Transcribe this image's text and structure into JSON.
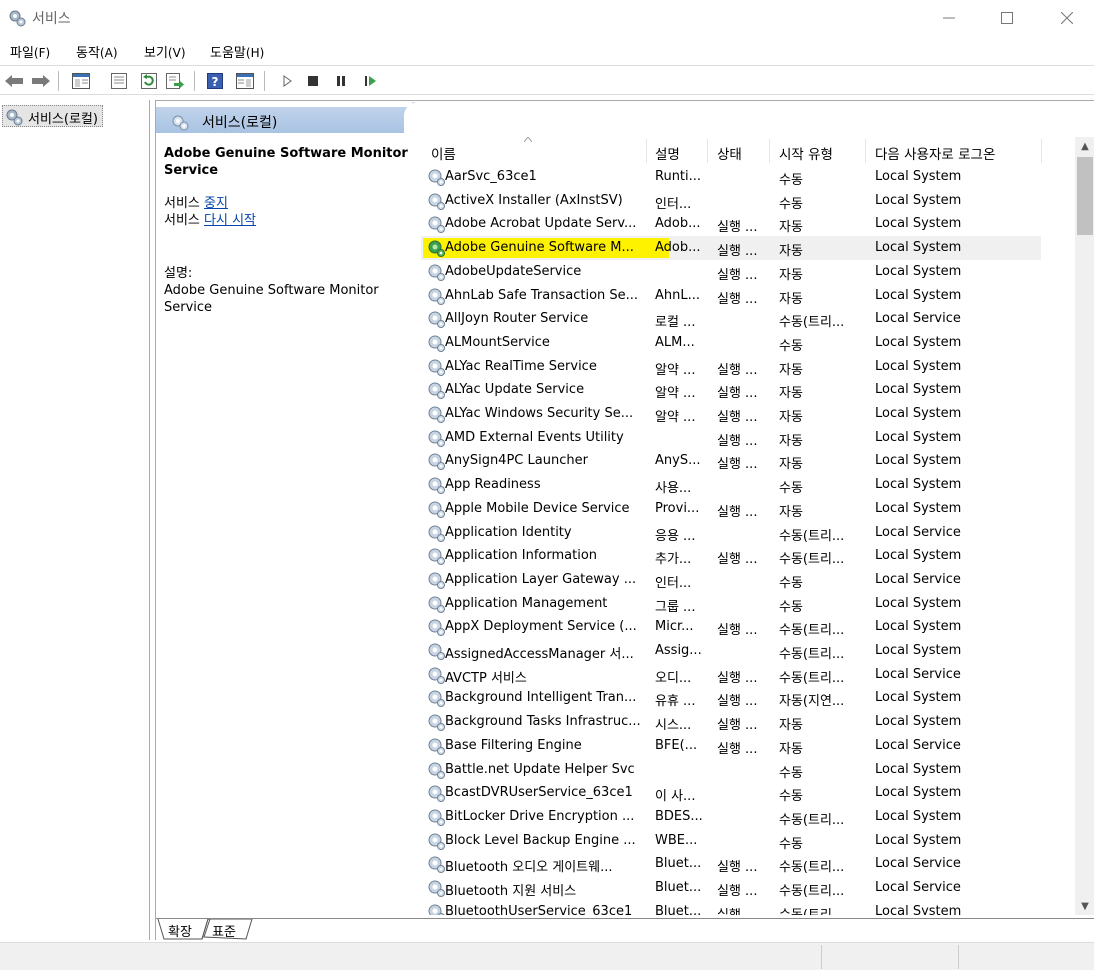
{
  "window": {
    "title": "서비스"
  },
  "menu": [
    {
      "label": "파일",
      "acc": "(F)"
    },
    {
      "label": "동작",
      "acc": "(A)"
    },
    {
      "label": "보기",
      "acc": "(V)"
    },
    {
      "label": "도움말",
      "acc": "(H)"
    }
  ],
  "tree": {
    "item": "서비스(로컬)"
  },
  "pane": {
    "title": "서비스(로컬)"
  },
  "details": {
    "service_name": "Adobe Genuine Software Monitor Service",
    "action_prefix_1": "서비스 ",
    "action_link_1": "중지",
    "action_prefix_2": "서비스 ",
    "action_link_2": "다시 시작",
    "desc_label": "설명:",
    "desc_text": "Adobe Genuine Software Monitor Service"
  },
  "columns": [
    "이름",
    "설명",
    "상태",
    "시작 유형",
    "다음 사용자로 로그온"
  ],
  "rows": [
    [
      "AarSvc_63ce1",
      "Runti...",
      "",
      "수동",
      "Local System"
    ],
    [
      "ActiveX Installer (AxInstSV)",
      "인터...",
      "",
      "수동",
      "Local System"
    ],
    [
      "Adobe Acrobat Update Serv...",
      "Adob...",
      "실행 ...",
      "자동",
      "Local System"
    ],
    [
      "Adobe Genuine Software M...",
      "Adob...",
      "실행 ...",
      "자동",
      "Local System"
    ],
    [
      "AdobeUpdateService",
      "",
      "실행 ...",
      "자동",
      "Local System"
    ],
    [
      "AhnLab Safe Transaction Se...",
      "AhnL...",
      "실행 ...",
      "자동",
      "Local System"
    ],
    [
      "AllJoyn Router Service",
      "로컬 ...",
      "",
      "수동(트리...",
      "Local Service"
    ],
    [
      "ALMountService",
      "ALM...",
      "",
      "수동",
      "Local System"
    ],
    [
      "ALYac RealTime Service",
      "알약 ...",
      "실행 ...",
      "자동",
      "Local System"
    ],
    [
      "ALYac Update Service",
      "알약 ...",
      "실행 ...",
      "자동",
      "Local System"
    ],
    [
      "ALYac Windows Security Se...",
      "알약 ...",
      "실행 ...",
      "자동",
      "Local System"
    ],
    [
      "AMD External Events Utility",
      "",
      "실행 ...",
      "자동",
      "Local System"
    ],
    [
      "AnySign4PC Launcher",
      "AnyS...",
      "실행 ...",
      "자동",
      "Local System"
    ],
    [
      "App Readiness",
      "사용...",
      "",
      "수동",
      "Local System"
    ],
    [
      "Apple Mobile Device Service",
      "Provi...",
      "실행 ...",
      "자동",
      "Local System"
    ],
    [
      "Application Identity",
      "응용 ...",
      "",
      "수동(트리...",
      "Local Service"
    ],
    [
      "Application Information",
      "추가...",
      "실행 ...",
      "수동(트리...",
      "Local System"
    ],
    [
      "Application Layer Gateway ...",
      "인터...",
      "",
      "수동",
      "Local Service"
    ],
    [
      "Application Management",
      "그룹 ...",
      "",
      "수동",
      "Local System"
    ],
    [
      "AppX Deployment Service (...",
      "Micr...",
      "실행 ...",
      "수동(트리...",
      "Local System"
    ],
    [
      "AssignedAccessManager 서...",
      "Assig...",
      "",
      "수동(트리...",
      "Local System"
    ],
    [
      "AVCTP 서비스",
      "오디...",
      "실행 ...",
      "수동(트리...",
      "Local Service"
    ],
    [
      "Background Intelligent Tran...",
      "유휴 ...",
      "실행 ...",
      "자동(지연...",
      "Local System"
    ],
    [
      "Background Tasks Infrastruc...",
      "시스...",
      "실행 ...",
      "자동",
      "Local System"
    ],
    [
      "Base Filtering Engine",
      "BFE(...",
      "실행 ...",
      "자동",
      "Local Service"
    ],
    [
      "Battle.net Update Helper Svc",
      "",
      "",
      "수동",
      "Local System"
    ],
    [
      "BcastDVRUserService_63ce1",
      "이 사...",
      "",
      "수동",
      "Local System"
    ],
    [
      "BitLocker Drive Encryption ...",
      "BDES...",
      "",
      "수동(트리...",
      "Local System"
    ],
    [
      "Block Level Backup Engine ...",
      "WBE...",
      "",
      "수동",
      "Local System"
    ],
    [
      "Bluetooth 오디오 게이트웨...",
      "Bluet...",
      "실행 ...",
      "수동(트리...",
      "Local Service"
    ],
    [
      "Bluetooth 지원 서비스",
      "Bluet...",
      "실행 ...",
      "수동(트리...",
      "Local Service"
    ],
    [
      "BluetoothUserService_63ce1",
      "Bluet...",
      "실행 ...",
      "수동(트리...",
      "Local System"
    ]
  ],
  "selected_row": 3,
  "tabs": [
    "확장",
    "표준"
  ]
}
